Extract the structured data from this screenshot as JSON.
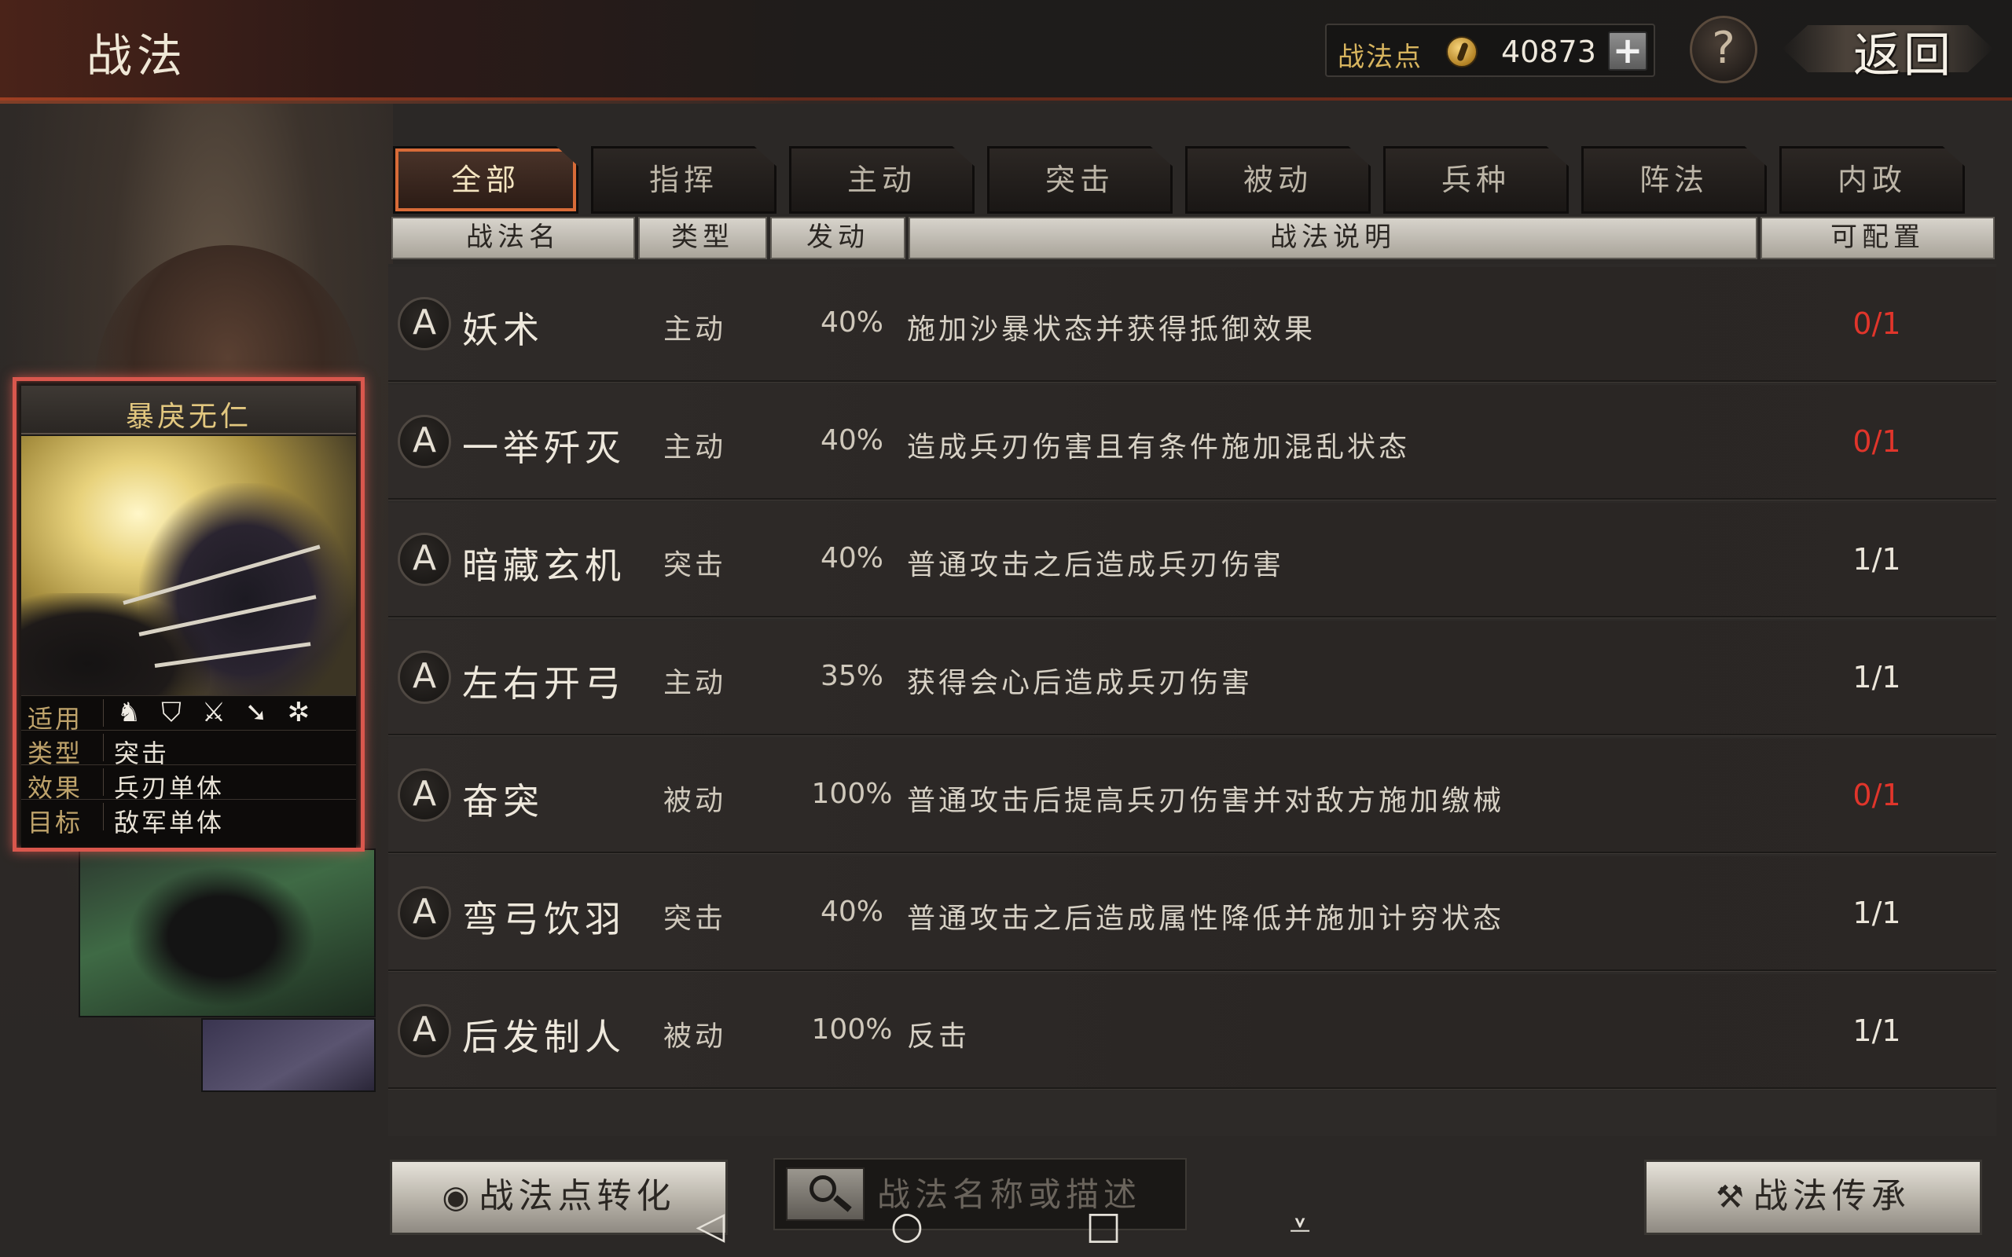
{
  "header": {
    "title": "战法",
    "points_label": "战法点",
    "points_value": "40873",
    "add_symbol": "+",
    "help_symbol": "?",
    "back_label": "返回"
  },
  "skill_card": {
    "name": "暴戾无仁",
    "props": [
      {
        "label": "适用",
        "value": ""
      },
      {
        "label": "类型",
        "value": "突击"
      },
      {
        "label": "效果",
        "value": "兵刃单体"
      },
      {
        "label": "目标",
        "value": "敌军单体"
      }
    ],
    "troop_icons": [
      "cavalry-icon",
      "shield-icon",
      "crossed-swords-icon",
      "arrow-icon",
      "wheel-icon"
    ],
    "frame_color": "#d9574d"
  },
  "tabs": [
    {
      "label": "全部",
      "active": true
    },
    {
      "label": "指挥",
      "active": false
    },
    {
      "label": "主动",
      "active": false
    },
    {
      "label": "突击",
      "active": false
    },
    {
      "label": "被动",
      "active": false
    },
    {
      "label": "兵种",
      "active": false
    },
    {
      "label": "阵法",
      "active": false
    },
    {
      "label": "内政",
      "active": false
    }
  ],
  "columns": {
    "name": "战法名",
    "type": "类型",
    "trigger": "发动",
    "desc": "战法说明",
    "config": "可配置"
  },
  "skills": [
    {
      "grade": "A",
      "name": "妖术",
      "type": "主动",
      "rate": "40%",
      "desc": "施加沙暴状态并获得抵御效果",
      "config": "0/1",
      "config_color": "#e0352b"
    },
    {
      "grade": "A",
      "name": "一举歼灭",
      "type": "主动",
      "rate": "40%",
      "desc": "造成兵刃伤害且有条件施加混乱状态",
      "config": "0/1",
      "config_color": "#e0352b"
    },
    {
      "grade": "A",
      "name": "暗藏玄机",
      "type": "突击",
      "rate": "40%",
      "desc": "普通攻击之后造成兵刃伤害",
      "config": "1/1",
      "config_color": "#ece6da"
    },
    {
      "grade": "A",
      "name": "左右开弓",
      "type": "主动",
      "rate": "35%",
      "desc": "获得会心后造成兵刃伤害",
      "config": "1/1",
      "config_color": "#ece6da"
    },
    {
      "grade": "A",
      "name": "奋突",
      "type": "被动",
      "rate": "100%",
      "desc": "普通攻击后提高兵刃伤害并对敌方施加缴械",
      "config": "0/1",
      "config_color": "#e0352b"
    },
    {
      "grade": "A",
      "name": "弯弓饮羽",
      "type": "突击",
      "rate": "40%",
      "desc": "普通攻击之后造成属性降低并施加计穷状态",
      "config": "1/1",
      "config_color": "#ece6da"
    },
    {
      "grade": "A",
      "name": "后发制人",
      "type": "被动",
      "rate": "100%",
      "desc": "反击",
      "config": "1/1",
      "config_color": "#ece6da"
    }
  ],
  "footer": {
    "convert_label": "战法点转化",
    "search_placeholder": "战法名称或描述",
    "inherit_label": "战法传承"
  },
  "android_nav": {
    "back": "◁",
    "home": "○",
    "recents": "□",
    "menu": "⩡"
  },
  "colors": {
    "accent": "#d86b38",
    "red": "#e0352b"
  }
}
